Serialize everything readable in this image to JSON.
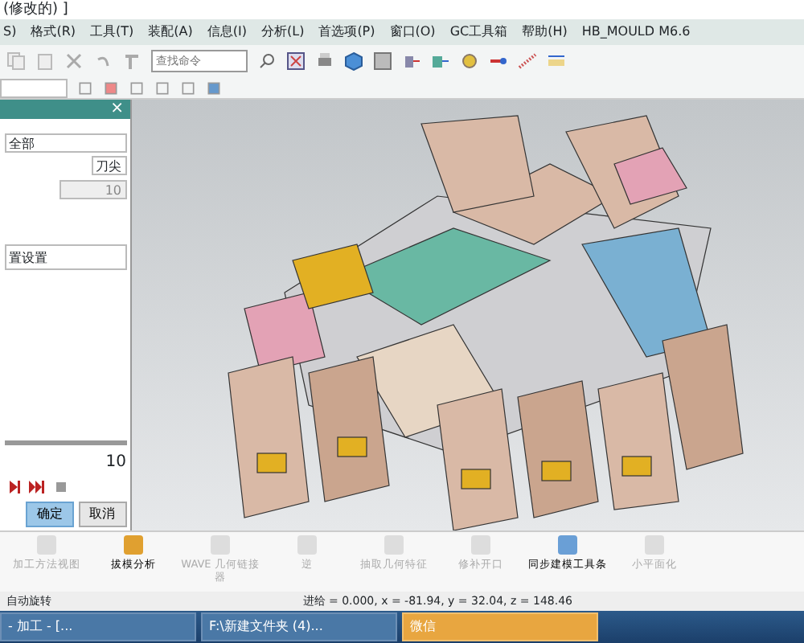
{
  "window": {
    "title": "(修改的) ]"
  },
  "menu": [
    "S)",
    "格式(R)",
    "工具(T)",
    "装配(A)",
    "信息(I)",
    "分析(L)",
    "首选项(P)",
    "窗口(O)",
    "GC工具箱",
    "帮助(H)",
    "HB_MOULD M6.6"
  ],
  "toolbar": {
    "search_placeholder": "查找命令"
  },
  "panel": {
    "close": "×",
    "filter": "全部",
    "tip": "刀尖",
    "count": "10",
    "settings": "置设置",
    "slider": {
      "level": 1,
      "reading": "10"
    },
    "buttons": [
      {
        "label": "确定",
        "primary": true
      },
      {
        "label": "取消",
        "primary": false
      }
    ]
  },
  "bottom_toolbar": [
    {
      "label": "加工方法视图",
      "disabled": true
    },
    {
      "label": "拔模分析",
      "disabled": false
    },
    {
      "label": "WAVE 几何链接器",
      "disabled": true
    },
    {
      "label": "逆",
      "disabled": true
    },
    {
      "label": "抽取几何特征",
      "disabled": true
    },
    {
      "label": "修补开口",
      "disabled": true
    },
    {
      "label": "同步建模工具条",
      "disabled": false
    },
    {
      "label": "小平面化",
      "disabled": true
    }
  ],
  "status_bar": {
    "message": "自动旋转",
    "coordinates": "进给 = 0.000, x = -81.94, y = 32.04, z = 148.46"
  },
  "taskbar": [
    {
      "label": "- 加工 - [...",
      "selected": false
    },
    {
      "label": "F:\\新建文件夹 (4)...",
      "selected": false
    },
    {
      "label": "微信",
      "selected": true
    }
  ]
}
